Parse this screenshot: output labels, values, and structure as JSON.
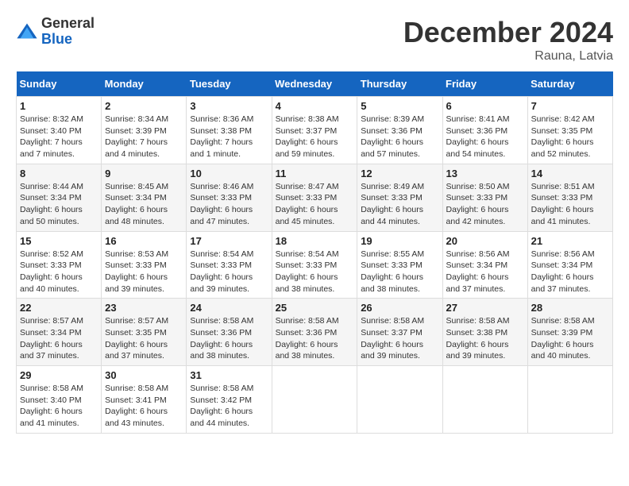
{
  "header": {
    "logo_general": "General",
    "logo_blue": "Blue",
    "month_title": "December 2024",
    "location": "Rauna, Latvia"
  },
  "days_of_week": [
    "Sunday",
    "Monday",
    "Tuesday",
    "Wednesday",
    "Thursday",
    "Friday",
    "Saturday"
  ],
  "weeks": [
    [
      {
        "day": "1",
        "sunrise": "8:32 AM",
        "sunset": "3:40 PM",
        "daylight": "7 hours and 7 minutes."
      },
      {
        "day": "2",
        "sunrise": "8:34 AM",
        "sunset": "3:39 PM",
        "daylight": "7 hours and 4 minutes."
      },
      {
        "day": "3",
        "sunrise": "8:36 AM",
        "sunset": "3:38 PM",
        "daylight": "7 hours and 1 minute."
      },
      {
        "day": "4",
        "sunrise": "8:38 AM",
        "sunset": "3:37 PM",
        "daylight": "6 hours and 59 minutes."
      },
      {
        "day": "5",
        "sunrise": "8:39 AM",
        "sunset": "3:36 PM",
        "daylight": "6 hours and 57 minutes."
      },
      {
        "day": "6",
        "sunrise": "8:41 AM",
        "sunset": "3:36 PM",
        "daylight": "6 hours and 54 minutes."
      },
      {
        "day": "7",
        "sunrise": "8:42 AM",
        "sunset": "3:35 PM",
        "daylight": "6 hours and 52 minutes."
      }
    ],
    [
      {
        "day": "8",
        "sunrise": "8:44 AM",
        "sunset": "3:34 PM",
        "daylight": "6 hours and 50 minutes."
      },
      {
        "day": "9",
        "sunrise": "8:45 AM",
        "sunset": "3:34 PM",
        "daylight": "6 hours and 48 minutes."
      },
      {
        "day": "10",
        "sunrise": "8:46 AM",
        "sunset": "3:33 PM",
        "daylight": "6 hours and 47 minutes."
      },
      {
        "day": "11",
        "sunrise": "8:47 AM",
        "sunset": "3:33 PM",
        "daylight": "6 hours and 45 minutes."
      },
      {
        "day": "12",
        "sunrise": "8:49 AM",
        "sunset": "3:33 PM",
        "daylight": "6 hours and 44 minutes."
      },
      {
        "day": "13",
        "sunrise": "8:50 AM",
        "sunset": "3:33 PM",
        "daylight": "6 hours and 42 minutes."
      },
      {
        "day": "14",
        "sunrise": "8:51 AM",
        "sunset": "3:33 PM",
        "daylight": "6 hours and 41 minutes."
      }
    ],
    [
      {
        "day": "15",
        "sunrise": "8:52 AM",
        "sunset": "3:33 PM",
        "daylight": "6 hours and 40 minutes."
      },
      {
        "day": "16",
        "sunrise": "8:53 AM",
        "sunset": "3:33 PM",
        "daylight": "6 hours and 39 minutes."
      },
      {
        "day": "17",
        "sunrise": "8:54 AM",
        "sunset": "3:33 PM",
        "daylight": "6 hours and 39 minutes."
      },
      {
        "day": "18",
        "sunrise": "8:54 AM",
        "sunset": "3:33 PM",
        "daylight": "6 hours and 38 minutes."
      },
      {
        "day": "19",
        "sunrise": "8:55 AM",
        "sunset": "3:33 PM",
        "daylight": "6 hours and 38 minutes."
      },
      {
        "day": "20",
        "sunrise": "8:56 AM",
        "sunset": "3:34 PM",
        "daylight": "6 hours and 37 minutes."
      },
      {
        "day": "21",
        "sunrise": "8:56 AM",
        "sunset": "3:34 PM",
        "daylight": "6 hours and 37 minutes."
      }
    ],
    [
      {
        "day": "22",
        "sunrise": "8:57 AM",
        "sunset": "3:34 PM",
        "daylight": "6 hours and 37 minutes."
      },
      {
        "day": "23",
        "sunrise": "8:57 AM",
        "sunset": "3:35 PM",
        "daylight": "6 hours and 37 minutes."
      },
      {
        "day": "24",
        "sunrise": "8:58 AM",
        "sunset": "3:36 PM",
        "daylight": "6 hours and 38 minutes."
      },
      {
        "day": "25",
        "sunrise": "8:58 AM",
        "sunset": "3:36 PM",
        "daylight": "6 hours and 38 minutes."
      },
      {
        "day": "26",
        "sunrise": "8:58 AM",
        "sunset": "3:37 PM",
        "daylight": "6 hours and 39 minutes."
      },
      {
        "day": "27",
        "sunrise": "8:58 AM",
        "sunset": "3:38 PM",
        "daylight": "6 hours and 39 minutes."
      },
      {
        "day": "28",
        "sunrise": "8:58 AM",
        "sunset": "3:39 PM",
        "daylight": "6 hours and 40 minutes."
      }
    ],
    [
      {
        "day": "29",
        "sunrise": "8:58 AM",
        "sunset": "3:40 PM",
        "daylight": "6 hours and 41 minutes."
      },
      {
        "day": "30",
        "sunrise": "8:58 AM",
        "sunset": "3:41 PM",
        "daylight": "6 hours and 43 minutes."
      },
      {
        "day": "31",
        "sunrise": "8:58 AM",
        "sunset": "3:42 PM",
        "daylight": "6 hours and 44 minutes."
      },
      null,
      null,
      null,
      null
    ]
  ],
  "labels": {
    "sunrise": "Sunrise:",
    "sunset": "Sunset:",
    "daylight": "Daylight:"
  }
}
